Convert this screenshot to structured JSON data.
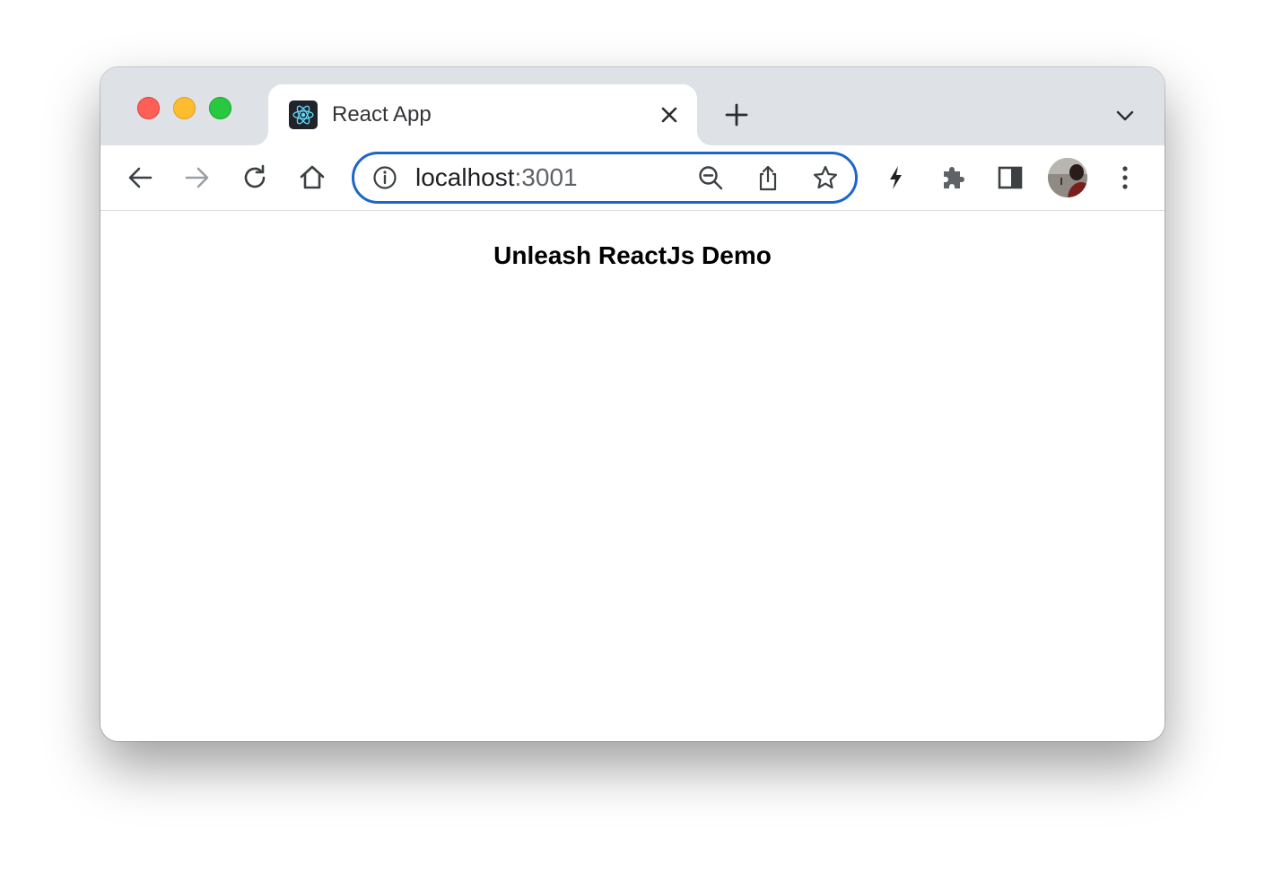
{
  "tab": {
    "title": "React App",
    "favicon": "react-logo-icon"
  },
  "toolbar": {
    "url_host": "localhost",
    "url_port": ":3001"
  },
  "page": {
    "heading": "Unleash ReactJs Demo"
  },
  "colors": {
    "omnibox_focus": "#1a66c9",
    "tabstrip": "#dee1e6",
    "react_blue": "#61dafb"
  }
}
